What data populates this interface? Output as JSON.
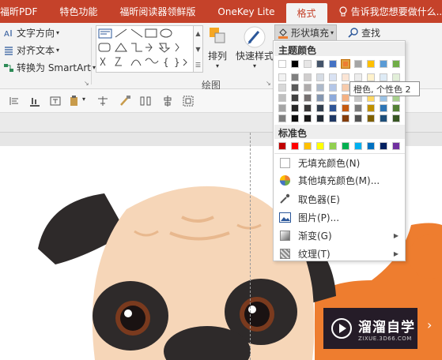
{
  "tabs": [
    {
      "label": "福昕PDF",
      "active": false
    },
    {
      "label": "特色功能",
      "active": false
    },
    {
      "label": "福昕阅读器领鲜版",
      "active": false
    },
    {
      "label": "OneKey Lite",
      "active": false
    },
    {
      "label": "格式",
      "active": true
    }
  ],
  "tell_me": "告诉我您想要做什么...",
  "ribbon": {
    "text_direction": "文字方向",
    "align_text": "对齐文本",
    "convert_smartart": "转换为 SmartArt",
    "arrange": "排列",
    "quick_styles": "快速样式",
    "shape_fill": "形状填充",
    "find": "查找",
    "group_drawing": "绘图"
  },
  "menu": {
    "theme_colors_label": "主题颜色",
    "standard_colors_label": "标准色",
    "items": [
      {
        "label": "无填充颜色(N)",
        "icon": "no-fill-icon",
        "submenu": false
      },
      {
        "label": "其他填充颜色(M)...",
        "icon": "color-wheel-icon",
        "submenu": false
      },
      {
        "label": "取色器(E)",
        "icon": "eyedropper-icon",
        "submenu": false
      },
      {
        "label": "图片(P)...",
        "icon": "picture-icon",
        "submenu": false
      },
      {
        "label": "渐变(G)",
        "icon": "gradient-icon",
        "submenu": true
      },
      {
        "label": "纹理(T)",
        "icon": "texture-icon",
        "submenu": true
      }
    ],
    "theme_top": [
      "#ffffff",
      "#000000",
      "#e7e6e6",
      "#44546a",
      "#4472c4",
      "#ed7d31",
      "#a5a5a5",
      "#ffc000",
      "#5b9bd5",
      "#70ad47"
    ],
    "theme_shades": [
      [
        "#f2f2f2",
        "#7f7f7f",
        "#d0cece",
        "#d6dce4",
        "#d9e2f3",
        "#fbe5d5",
        "#ededed",
        "#fff2cc",
        "#deebf6",
        "#e2efd9"
      ],
      [
        "#d8d8d8",
        "#595959",
        "#aeabab",
        "#adb9ca",
        "#b4c6e7",
        "#f7cbac",
        "#dbdbdb",
        "#fee599",
        "#bdd7ee",
        "#c5e0b3"
      ],
      [
        "#bfbfbf",
        "#3f3f3f",
        "#757070",
        "#8496b0",
        "#8eaadb",
        "#f4b183",
        "#c9c9c9",
        "#ffd965",
        "#9cc3e5",
        "#a8d08d"
      ],
      [
        "#a5a5a5",
        "#262626",
        "#3a3838",
        "#323f4f",
        "#2f5496",
        "#c55a11",
        "#7b7b7b",
        "#bf9000",
        "#2e75b5",
        "#538135"
      ],
      [
        "#7f7f7f",
        "#0c0c0c",
        "#171616",
        "#222a35",
        "#1f3864",
        "#833c0b",
        "#525252",
        "#7f6000",
        "#1e4e79",
        "#375623"
      ]
    ],
    "standard": [
      "#c00000",
      "#ff0000",
      "#ffc000",
      "#ffff00",
      "#92d050",
      "#00b050",
      "#00b0f0",
      "#0070c0",
      "#002060",
      "#7030a0"
    ]
  },
  "tooltip": "橙色, 个性色 2",
  "watermark": {
    "title": "溜溜自学",
    "subtitle": "ZIXUE.3D66.COM"
  },
  "colors": {
    "accent": "#c5422a",
    "pug_fur": "#f6d6b8",
    "orange_shape": "#ee7d2f"
  }
}
